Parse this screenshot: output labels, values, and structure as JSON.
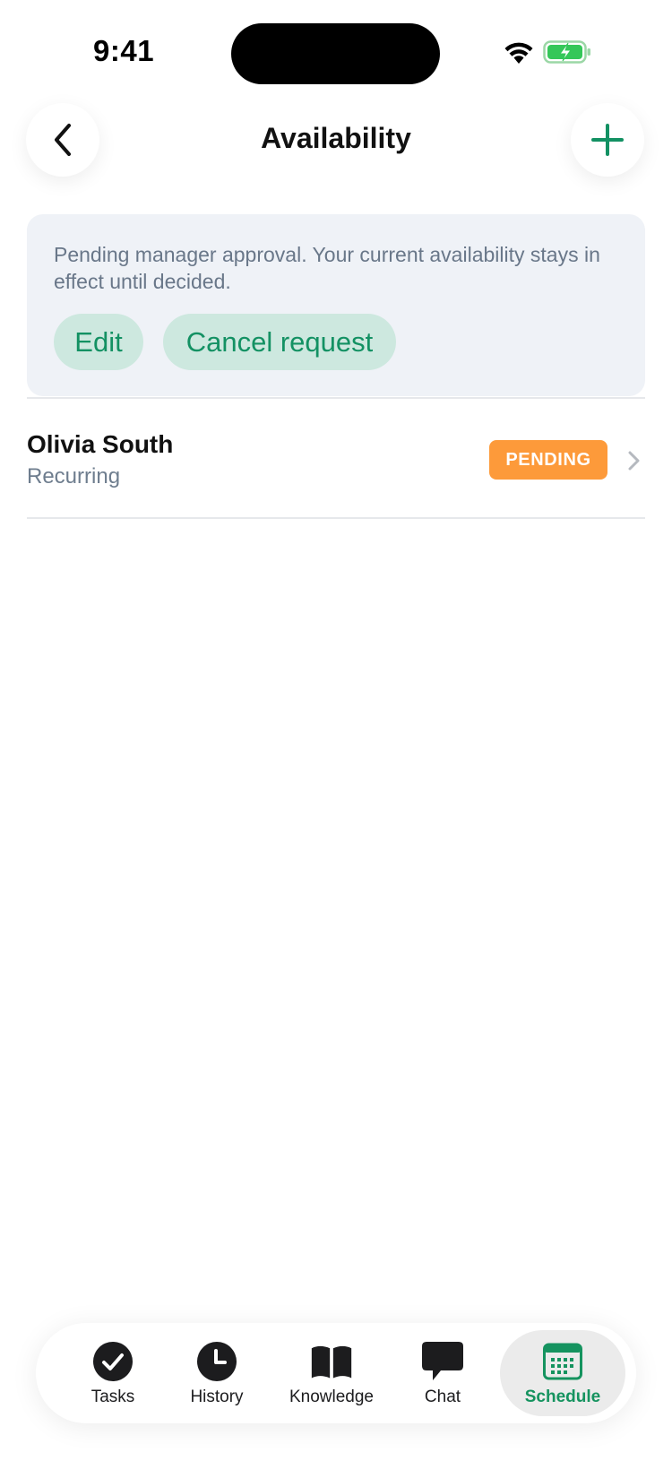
{
  "status_bar": {
    "time": "9:41"
  },
  "header": {
    "title": "Availability",
    "back_icon": "chevron-left-icon",
    "add_icon": "plus-icon",
    "accent_color": "#139163"
  },
  "notice": {
    "message": "Pending manager approval. Your current availability stays in effect until decided.",
    "edit_label": "Edit",
    "cancel_label": "Cancel request"
  },
  "entry": {
    "name": "Olivia South",
    "subtitle": "Recurring",
    "status": "PENDING",
    "status_color": "#fd9a3a"
  },
  "tabbar": {
    "tabs": [
      {
        "label": "Tasks",
        "icon": "check-circle-icon"
      },
      {
        "label": "History",
        "icon": "clock-icon"
      },
      {
        "label": "Knowledge",
        "icon": "book-icon"
      },
      {
        "label": "Chat",
        "icon": "chat-bubble-icon"
      },
      {
        "label": "Schedule",
        "icon": "calendar-icon",
        "active": true
      }
    ],
    "active_color": "#15935f"
  }
}
